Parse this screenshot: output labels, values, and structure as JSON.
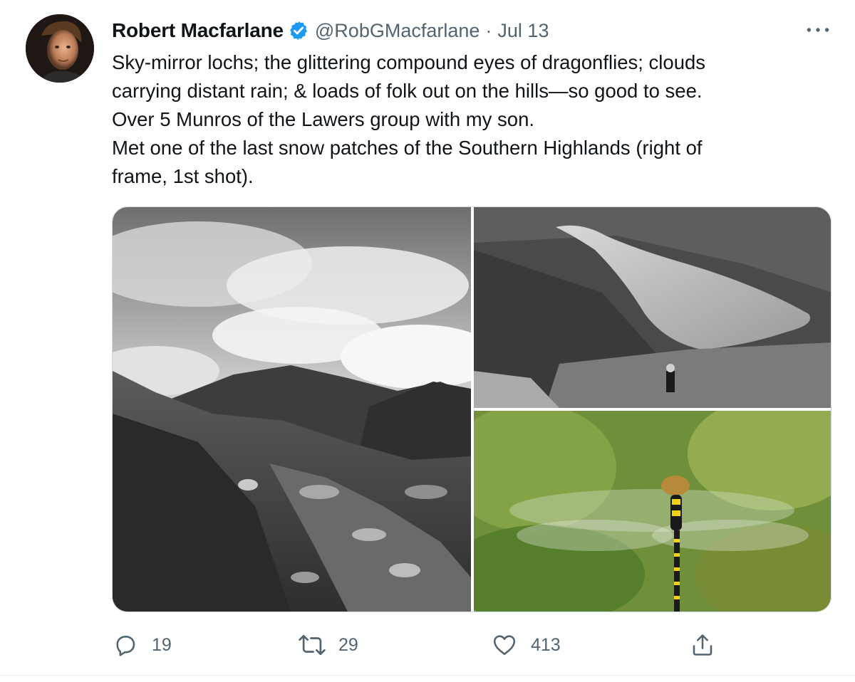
{
  "tweet": {
    "author": {
      "display_name": "Robert Macfarlane",
      "handle": "@RobGMacfarlane",
      "verified": true,
      "avatar": "author-avatar-photo"
    },
    "separator": "·",
    "timestamp": "Jul 13",
    "more_icon": "more-horizontal-icon",
    "text_lines": [
      "Sky-mirror lochs; the glittering compound eyes of dragonflies; clouds",
      "carrying distant rain; & loads of folk out on the hills—so good to see.",
      "Over 5 Munros of the Lawers group with my son.",
      "Met one of the last snow patches of the Southern Highlands (right of",
      "frame, 1st shot)."
    ],
    "media": [
      {
        "name": "photo-mountain-path",
        "description_icon": "mountain-photo"
      },
      {
        "name": "photo-loch-hiker",
        "description_icon": "loch-photo"
      },
      {
        "name": "photo-dragonfly",
        "description_icon": "dragonfly-photo"
      }
    ],
    "actions": {
      "reply": {
        "icon": "reply-icon",
        "count": "19"
      },
      "retweet": {
        "icon": "retweet-icon",
        "count": "29"
      },
      "like": {
        "icon": "heart-icon",
        "count": "413"
      },
      "share": {
        "icon": "share-icon"
      }
    },
    "colors": {
      "verified_blue": "#1d9bf0",
      "secondary_text": "#536471",
      "primary_text": "#0f1419"
    }
  }
}
